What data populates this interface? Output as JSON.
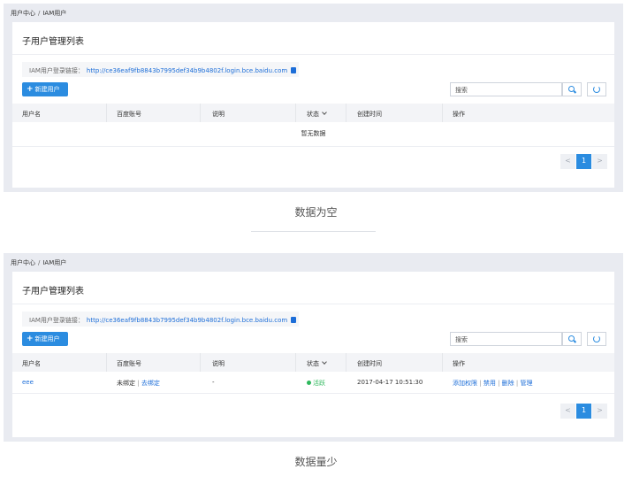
{
  "breadcrumb": {
    "root": "用户中心",
    "separator": "/",
    "current": "IAM用户"
  },
  "card": {
    "title": "子用户管理列表",
    "login_label": "IAM用户登录链接：",
    "login_url": "http://ce36eaf9fb8843b7995def34b9b4802f.login.bce.baidu.com",
    "new_user_label": "新建用户",
    "search_placeholder": "搜索"
  },
  "table": {
    "columns": [
      "用户名",
      "百度账号",
      "说明",
      "状态",
      "创建时间",
      "操作"
    ]
  },
  "empty_state": {
    "text": "暂无数据",
    "caption": "数据为空"
  },
  "few_state": {
    "caption": "数据量少",
    "rows": [
      {
        "username": "eee",
        "baidu_unbound": "未绑定",
        "baidu_sep": "|",
        "baidu_bind": "去绑定",
        "desc": "-",
        "status": "活跃",
        "created": "2017-04-17 10:51:30",
        "op_add_perm": "添加权限",
        "op_disable": "禁用",
        "op_delete": "删除",
        "op_manage": "管理",
        "op_sep": "|"
      }
    ]
  },
  "pager": {
    "prev": "<",
    "current": "1",
    "next": ">"
  },
  "colors": {
    "accent": "#2b8ce0",
    "link": "#1d6ed8",
    "active": "#2eb85c",
    "frame": "#e9ebf1"
  },
  "icons": [
    "search-icon",
    "refresh-icon",
    "copy-icon",
    "plus-icon",
    "chevron-down-icon"
  ]
}
